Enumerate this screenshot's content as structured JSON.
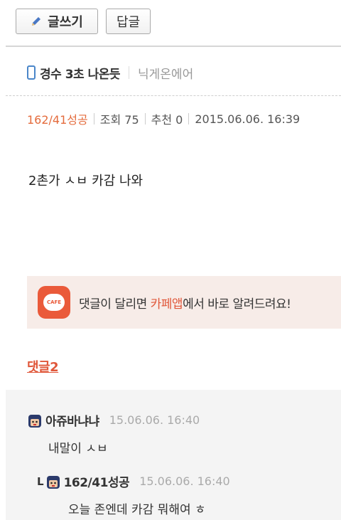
{
  "toolbar": {
    "write_label": "글쓰기",
    "reply_label": "답글"
  },
  "post": {
    "title": "경수 3초 나온듯",
    "nickname": "닉게온에어",
    "author": "162/41성공",
    "views": "조회 75",
    "recommend": "추천 0",
    "datetime": "2015.06.06. 16:39",
    "body": "2촌가 ㅅㅂ 카감 나와"
  },
  "banner": {
    "icon_text": "CAFE",
    "pre": "댓글이 달리면 ",
    "highlight": "카페앱",
    "post": "에서 바로 알려드려요!"
  },
  "comments": {
    "header": "댓글2",
    "items": [
      {
        "name": "아쥬바냐냐",
        "time": "15.06.06. 16:40",
        "text": "내말이 ㅅㅂ"
      },
      {
        "reply_mark": "L",
        "name": "162/41성공",
        "time": "15.06.06. 16:40",
        "text": "오늘 존엔데 카감 뭐해여 ㅎ"
      }
    ]
  },
  "colors": {
    "accent": "#e0573a",
    "author": "#e46b3c",
    "phone_icon": "#4a86c9",
    "banner_bg": "#f7ece8"
  }
}
